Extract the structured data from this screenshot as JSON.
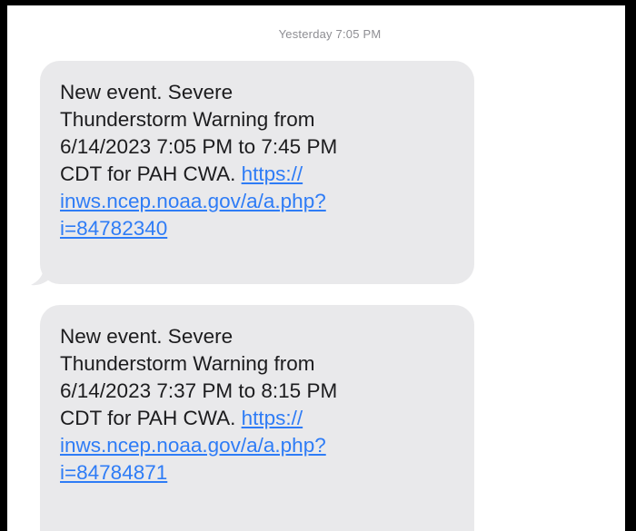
{
  "conversation": {
    "timestamp": "Yesterday 7:05 PM",
    "messages": [
      {
        "lines": [
          "New event. Severe",
          "Thunderstorm Warning from",
          "6/14/2023 7:05 PM to 7:45 PM"
        ],
        "text_before_link": "CDT for PAH CWA. ",
        "link_parts": [
          "https://",
          "inws.ncep.noaa.gov/a/a.php?",
          "i=84782340"
        ]
      },
      {
        "lines": [
          "New event. Severe",
          "Thunderstorm Warning from",
          "6/14/2023 7:37 PM to 8:15 PM"
        ],
        "text_before_link": "CDT for PAH CWA. ",
        "link_parts": [
          "https://",
          "inws.ncep.noaa.gov/a/a.php?",
          "i=84784871"
        ]
      }
    ]
  },
  "colors": {
    "bubble_background": "#e9e9eb",
    "link": "#2e7cf6",
    "timestamp_text": "#8e8e93",
    "frame_border": "#000000"
  }
}
